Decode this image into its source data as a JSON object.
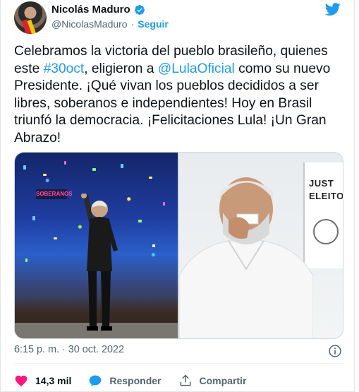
{
  "author": {
    "display_name": "Nicolás Maduro",
    "handle": "@NicolasMaduro",
    "separator": "·",
    "follow_label": "Seguir"
  },
  "tweet": {
    "segments": [
      {
        "text": "Celebramos la victoria del pueblo brasileño, quienes\neste ",
        "link": false
      },
      {
        "text": "#30oct",
        "link": true
      },
      {
        "text": ", eligieron a ",
        "link": false
      },
      {
        "text": "@LulaOficial",
        "link": true
      },
      {
        "text": " como su nuevo\nPresidente. ¡Qué vivan los pueblos decididos a ser\nlibres, soberanos e independientes! Hoy en Brasil\ntriunfó la democracia. ¡Felicitaciones Lula! ¡Un Gran\nAbrazo!",
        "link": false
      }
    ]
  },
  "media": {
    "left_banner": "SOBERANOS",
    "right_sign_lines": [
      "JUST",
      "ELEITO"
    ]
  },
  "timestamp": "6:15 p. m. · 30 oct. 2022",
  "actions": {
    "like_count": "14,3 mil",
    "reply_label": "Responder",
    "share_label": "Compartir"
  },
  "colors": {
    "link": "#1d9bf0",
    "like": "#f91880",
    "secondary_text": "#536471"
  },
  "icons": [
    "verified-badge-icon",
    "twitter-bird-icon",
    "info-icon",
    "heart-icon",
    "reply-bubble-icon",
    "share-icon"
  ]
}
